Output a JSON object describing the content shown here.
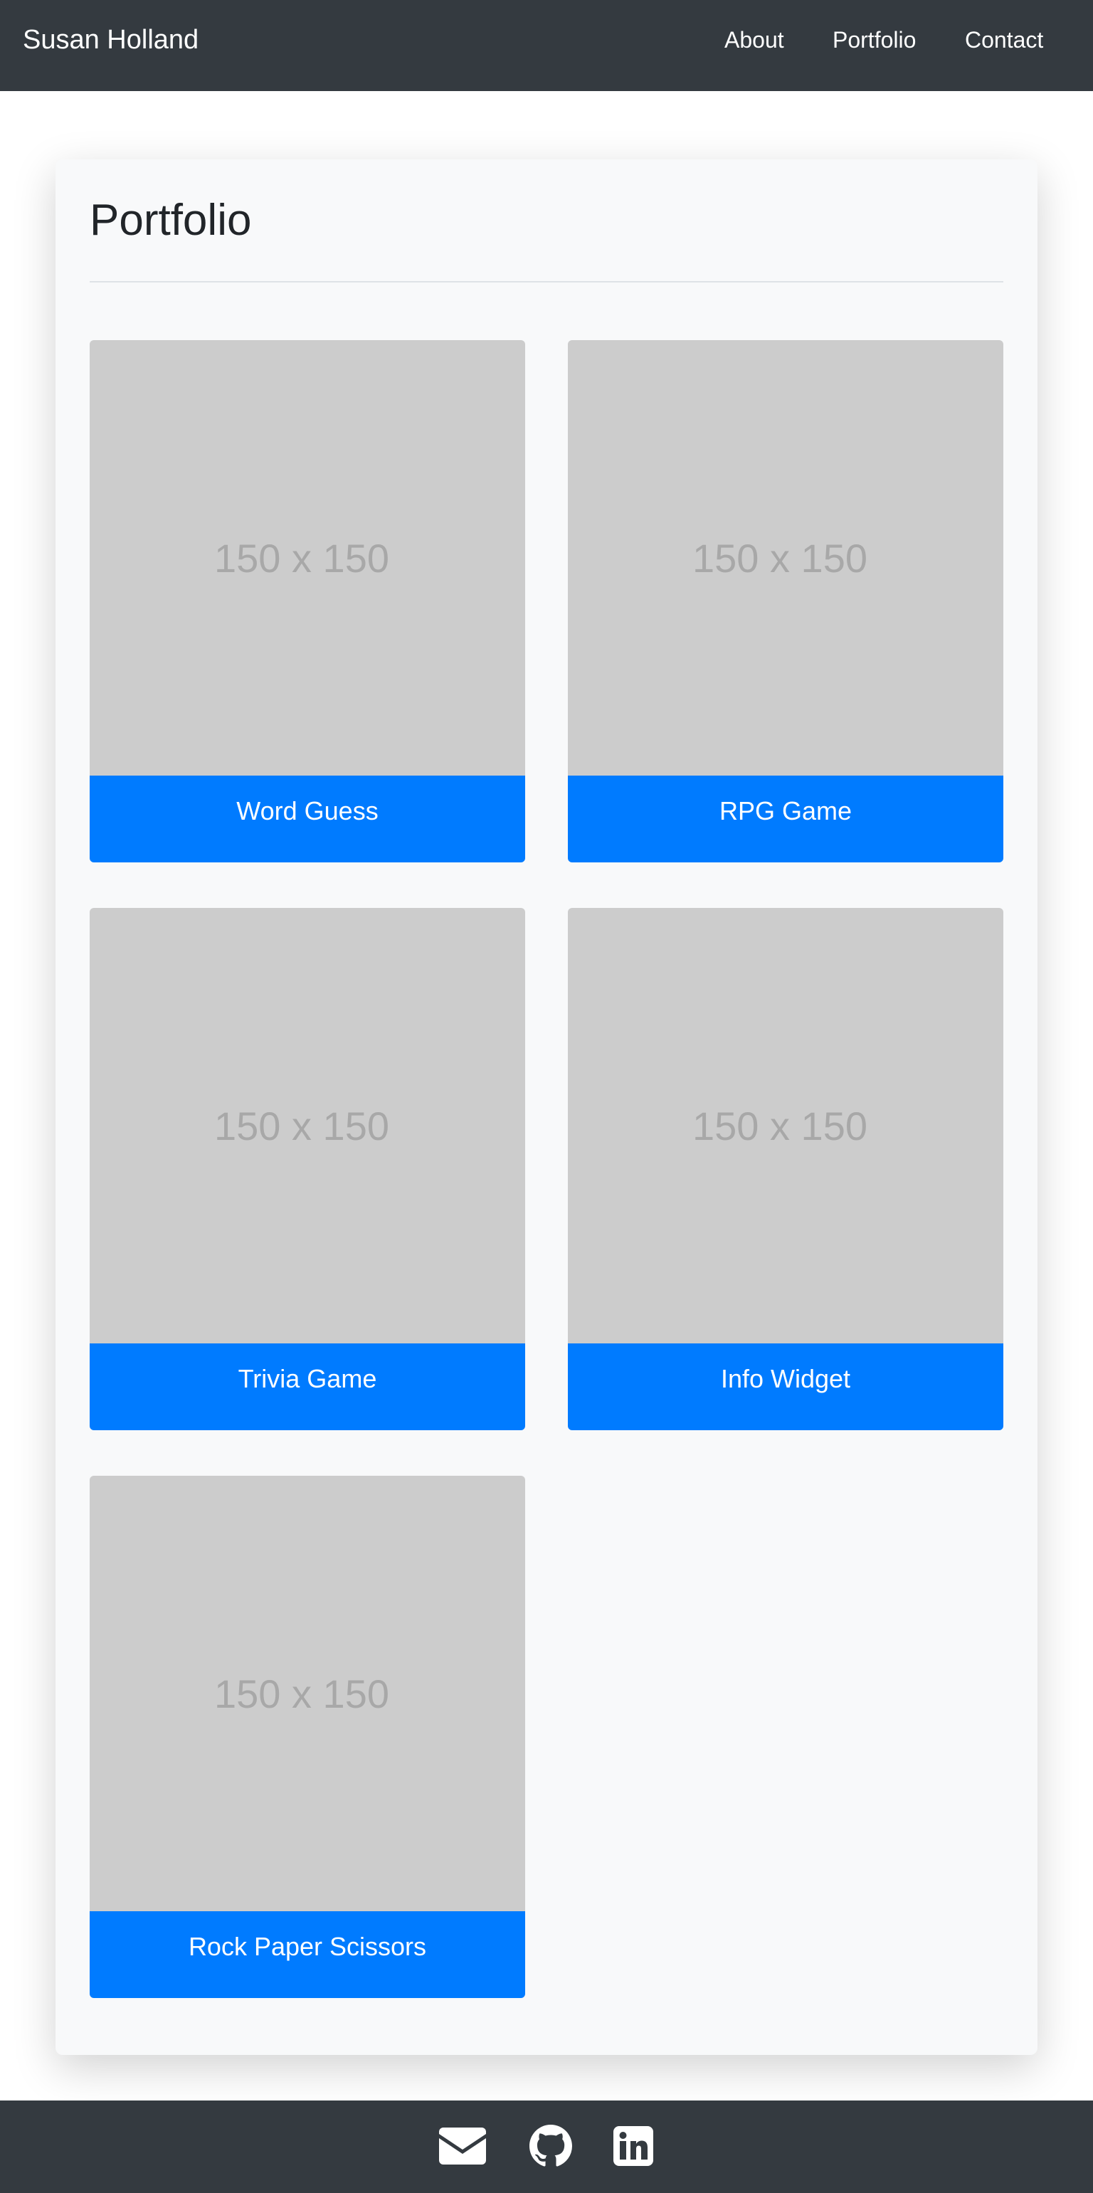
{
  "nav": {
    "brand": "Susan Holland",
    "links": [
      "About",
      "Portfolio",
      "Contact"
    ]
  },
  "portfolio": {
    "title": "Portfolio",
    "placeholder_text": "150 x 150",
    "projects": [
      {
        "name": "Word Guess"
      },
      {
        "name": "RPG Game"
      },
      {
        "name": "Trivia Game"
      },
      {
        "name": "Info Widget"
      },
      {
        "name": "Rock Paper Scissors"
      }
    ]
  },
  "footer": {
    "icons": [
      "envelope-icon",
      "github-icon",
      "linkedin-icon"
    ]
  },
  "colors": {
    "navbar": "#343a40",
    "panel": "#f8f9fa",
    "placeholder": "#cccccc",
    "caption": "#007bff"
  }
}
